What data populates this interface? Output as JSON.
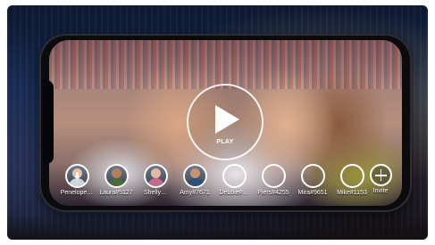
{
  "player": {
    "play_label": "PLAY"
  },
  "participants": [
    {
      "name": "Penelope…",
      "skin": "#c99275",
      "shirt": "#3a3c48"
    },
    {
      "name": "Laura#5127",
      "skin": "#e6bfa4",
      "shirt": "#cfd3da"
    },
    {
      "name": "Shelly…",
      "skin": "#d3a07a",
      "shirt": "#2a2a2e"
    },
    {
      "name": "Amy#7671",
      "skin": "#b87e5c",
      "shirt": "#4b6a3a"
    },
    {
      "name": "Debbie#…",
      "skin": "#e8c0a2",
      "shirt": "#b8322f"
    },
    {
      "name": "Piers#4255",
      "skin": "#e5b9a1",
      "shirt": "#c46a8f"
    },
    {
      "name": "Mira#9651",
      "skin": "#d9a27a",
      "shirt": "#8e3a34"
    },
    {
      "name": "Mike#1153",
      "skin": "#c89270",
      "shirt": "#2f4f7a"
    }
  ],
  "invite": {
    "label": "Invite"
  },
  "colors": {
    "ring": "#ffffff",
    "phone_frame": "#0b0b0d"
  }
}
